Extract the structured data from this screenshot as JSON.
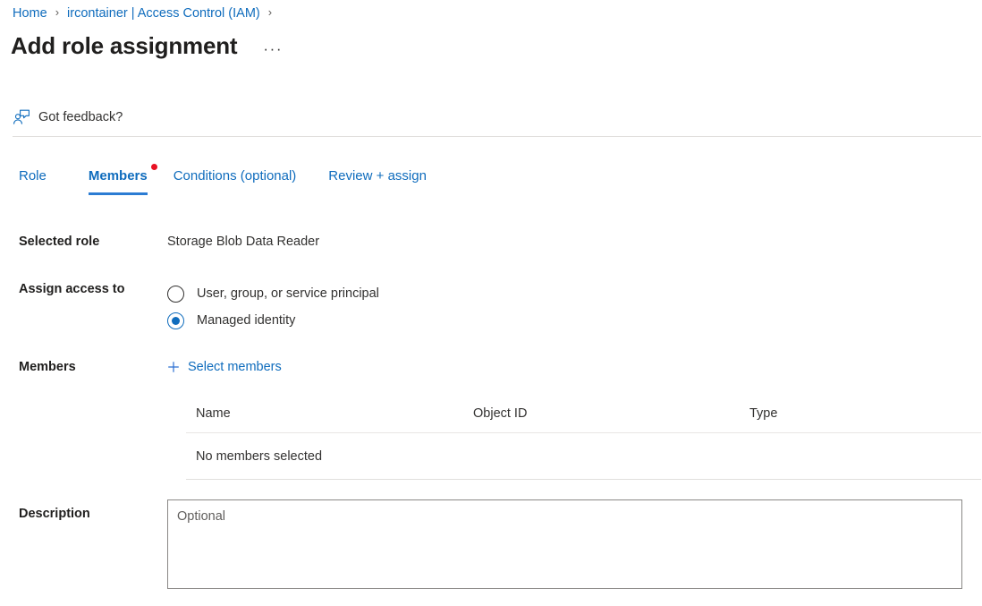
{
  "breadcrumb": {
    "items": [
      {
        "label": "Home",
        "link": true
      },
      {
        "label": "ircontainer | Access Control (IAM)",
        "link": true
      }
    ],
    "separator": "›"
  },
  "header": {
    "title": "Add role assignment",
    "more_label": "···"
  },
  "command_bar": {
    "feedback_label": "Got feedback?",
    "feedback_icon": "person-feedback-icon"
  },
  "tabs": [
    {
      "label": "Role",
      "active": false,
      "badge": false
    },
    {
      "label": "Members",
      "active": true,
      "badge": true
    },
    {
      "label": "Conditions (optional)",
      "active": false,
      "badge": false
    },
    {
      "label": "Review + assign",
      "active": false,
      "badge": false
    }
  ],
  "form": {
    "selected_role": {
      "label": "Selected role",
      "value": "Storage Blob Data Reader"
    },
    "assign_access_to": {
      "label": "Assign access to",
      "options": [
        {
          "label": "User, group, or service principal",
          "checked": false
        },
        {
          "label": "Managed identity",
          "checked": true
        }
      ]
    },
    "members": {
      "label": "Members",
      "select_members_label": "Select members",
      "plus_icon": "plus-icon"
    },
    "description": {
      "label": "Description",
      "placeholder": "Optional",
      "value": ""
    }
  },
  "members_table": {
    "columns": [
      "Name",
      "Object ID",
      "Type"
    ],
    "empty_message": "No members selected",
    "rows": []
  },
  "colors": {
    "link": "#0f6cbd",
    "tab_active_underline": "#2b7cd3",
    "badge_red": "#e81123",
    "text": "#323130",
    "divider": "#e1dfdd"
  }
}
